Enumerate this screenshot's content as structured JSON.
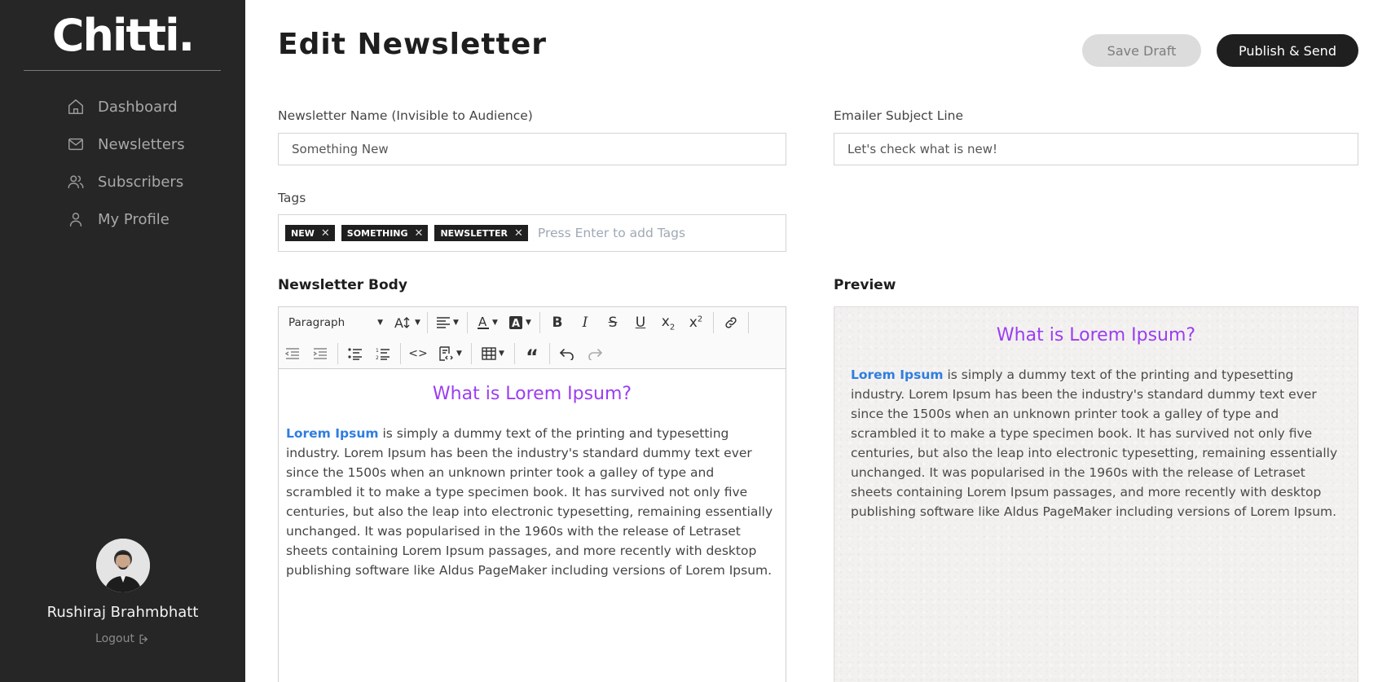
{
  "sidebar": {
    "logo": "Chitti.",
    "items": [
      {
        "label": "Dashboard",
        "icon": "home-icon"
      },
      {
        "label": "Newsletters",
        "icon": "mail-icon"
      },
      {
        "label": "Subscribers",
        "icon": "users-icon"
      },
      {
        "label": "My Profile",
        "icon": "user-icon"
      }
    ],
    "user_name": "Rushiraj Brahmbhatt",
    "logout_label": "Logout"
  },
  "header": {
    "title": "Edit Newsletter",
    "save_draft_label": "Save Draft",
    "publish_label": "Publish & Send"
  },
  "form": {
    "name_label": "Newsletter Name (Invisible to Audience)",
    "name_value": "Something New",
    "subject_label": "Emailer Subject Line",
    "subject_value": "Let's check what is new!",
    "tags_label": "Tags",
    "tags": [
      "NEW",
      "SOMETHING",
      "NEWSLETTER"
    ],
    "tags_placeholder": "Press Enter to add Tags",
    "body_label": "Newsletter Body",
    "preview_label": "Preview"
  },
  "editor": {
    "paragraph_select": "Paragraph",
    "heading": "What is Lorem Ipsum?",
    "highlight": "Lorem Ipsum",
    "body": " is simply a dummy text of the printing and typesetting industry. Lorem Ipsum has been the industry's standard dummy text ever since the 1500s when an unknown printer took a galley of type and scrambled it to make a type specimen book. It has survived not only five centuries, but also the leap into electronic typesetting, remaining essentially unchanged. It was popularised in the 1960s with the release of Letraset sheets containing Lorem Ipsum passages, and more recently with desktop publishing software like Aldus PageMaker including versions of Lorem Ipsum."
  },
  "colors": {
    "sidebar_bg": "#262626",
    "heading_purple": "#9b3df2",
    "link_blue": "#2f7ee0",
    "primary_button": "#1f1f1f"
  }
}
